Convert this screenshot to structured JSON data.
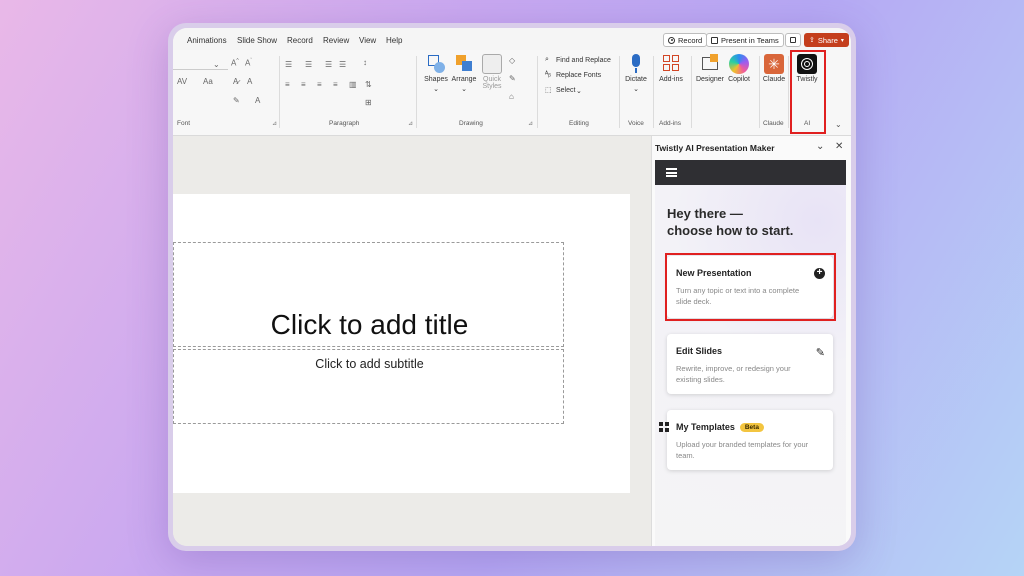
{
  "menu": {
    "tabs": [
      "Animations",
      "Slide Show",
      "Record",
      "Review",
      "View",
      "Help"
    ],
    "record_label": "Record",
    "present_teams_label": "Present in Teams",
    "share_label": "Share"
  },
  "ribbon": {
    "groups": {
      "font": "Font",
      "paragraph": "Paragraph",
      "drawing": "Drawing",
      "editing": "Editing",
      "voice": "Voice",
      "addins": "Add-ins",
      "claude": "Claude",
      "ai": "AI"
    },
    "buttons": {
      "shapes": "Shapes",
      "arrange": "Arrange",
      "quick_styles_1": "Quick",
      "quick_styles_2": "Styles",
      "find_replace": "Find and Replace",
      "replace_fonts": "Replace Fonts",
      "select": "Select",
      "dictate": "Dictate",
      "addins": "Add-ins",
      "designer": "Designer",
      "copilot": "Copilot",
      "claude": "Claude",
      "twistly": "Twistly"
    }
  },
  "slide": {
    "title_placeholder": "Click to add title",
    "subtitle_placeholder": "Click to add subtitle"
  },
  "panel": {
    "title": "Twistly AI Presentation Maker",
    "greeting_line1": "Hey there —",
    "greeting_line2": "choose how to start.",
    "cards": [
      {
        "title": "New Presentation",
        "desc": "Turn any topic or text into a complete slide deck.",
        "icon": "plus-circle-icon"
      },
      {
        "title": "Edit Slides",
        "desc": "Rewrite, improve, or redesign your existing slides.",
        "icon": "pencil-icon"
      },
      {
        "title": "My Templates",
        "badge": "Beta",
        "desc": "Upload your branded templates for your team.",
        "icon": "grid-icon"
      }
    ]
  },
  "colors": {
    "highlight": "#e02020",
    "share": "#c43e1c",
    "panel_bar": "#2f2f33",
    "beta_badge": "#f3c540"
  }
}
